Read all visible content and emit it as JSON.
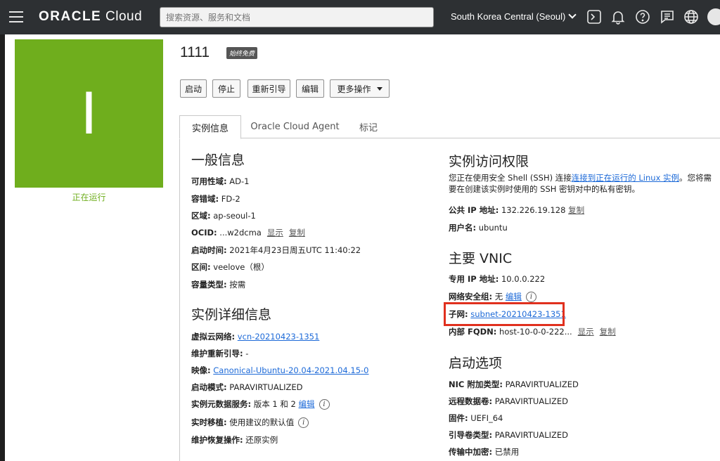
{
  "header": {
    "brand_bold": "ORACLE",
    "brand_light": " Cloud",
    "search_placeholder": "搜索资源、服务和文档",
    "region": "South Korea Central (Seoul)"
  },
  "instance": {
    "name": "1111",
    "badge": "始终免费",
    "avatar_letter": "I",
    "status": "正在运行",
    "status_color": "#6fae1d"
  },
  "actions": {
    "start": "启动",
    "stop": "停止",
    "reboot": "重新引导",
    "edit": "编辑",
    "more": "更多操作"
  },
  "tabs": {
    "info": "实例信息",
    "agent": "Oracle Cloud Agent",
    "tags": "标记"
  },
  "general": {
    "heading": "一般信息",
    "ad_label": "可用性域:",
    "ad_value": " AD-1",
    "fd_label": "容错域:",
    "fd_value": " FD-2",
    "region_label": "区域:",
    "region_value": " ap-seoul-1",
    "ocid_label": "OCID:",
    "ocid_value": " ...w2dcma",
    "ocid_show": "显示",
    "ocid_copy": "复制",
    "launched_label": "启动时间:",
    "launched_value": " 2021年4月23日周五UTC 11:40:22",
    "compartment_label": "区间:",
    "compartment_value": " veelove（根）",
    "capacity_label": "容量类型:",
    "capacity_value": " 按需"
  },
  "details": {
    "heading": "实例详细信息",
    "vcn_label": "虚拟云网络:",
    "vcn_value": "vcn-20210423-1351",
    "maint_label": "维护重新引导:",
    "maint_value": " -",
    "image_label": "映像:",
    "image_value": "Canonical-Ubuntu-20.04-2021.04.15-0",
    "launch_mode_label": "启动模式:",
    "launch_mode_value": " PARAVIRTUALIZED",
    "metadata_label": "实例元数据服务:",
    "metadata_value": " 版本 1 和 2 ",
    "metadata_edit": "编辑",
    "migration_label": "实时移植:",
    "migration_value": " 使用建议的默认值",
    "recovery_label": "维护恢复操作:",
    "recovery_value": " 还原实例"
  },
  "access": {
    "heading": "实例访问权限",
    "para_before": "您正在使用安全 Shell (SSH) 连接",
    "para_link": "连接到正在运行的 Linux 实例",
    "para_after": "。您将需要在创建该实例时使用的 SSH 密钥对中的私有密钥。",
    "public_ip_label": "公共 IP 地址:",
    "public_ip_value": " 132.226.19.128",
    "public_ip_copy": "复制",
    "username_label": "用户名:",
    "username_value": " ubuntu"
  },
  "vnic": {
    "heading": "主要 VNIC",
    "private_ip_label": "专用 IP 地址:",
    "private_ip_value": " 10.0.0.222",
    "nsg_label": "网络安全组:",
    "nsg_value": " 无 ",
    "nsg_edit": "编辑",
    "subnet_label": "子网:",
    "subnet_value": "subnet-20210423-1351",
    "fqdn_label": "内部 FQDN:",
    "fqdn_value": " host-10-0-0-222...",
    "fqdn_show": "显示",
    "fqdn_copy": "复制"
  },
  "launch_options": {
    "heading": "启动选项",
    "nic_label": "NIC 附加类型:",
    "nic_value": " PARAVIRTUALIZED",
    "remote_label": "远程数据卷:",
    "remote_value": " PARAVIRTUALIZED",
    "firmware_label": "固件:",
    "firmware_value": " UEFI_64",
    "boot_label": "引导卷类型:",
    "boot_value": " PARAVIRTUALIZED",
    "transit_label": "传输中加密:",
    "transit_value": " 已禁用"
  }
}
